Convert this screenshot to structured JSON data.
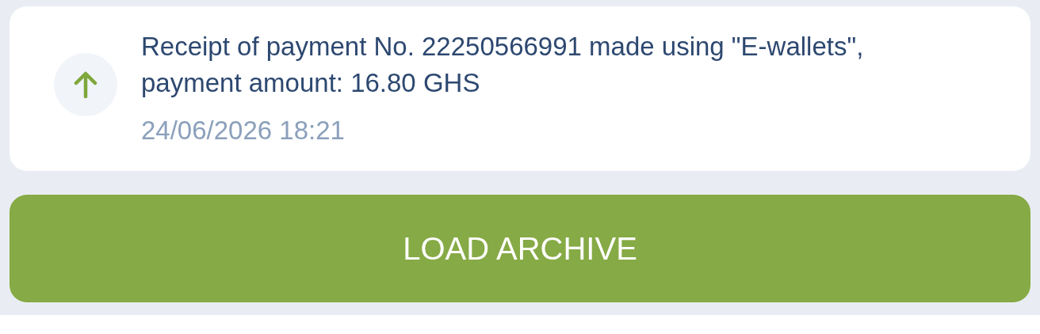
{
  "notification": {
    "incoming": true,
    "message": "Receipt of payment No. 22250566991 made using \"E-wallets\", payment amount: 16.80 GHS",
    "timestamp": "24/06/2026 18:21"
  },
  "load_button": {
    "label": "LOAD ARCHIVE"
  }
}
